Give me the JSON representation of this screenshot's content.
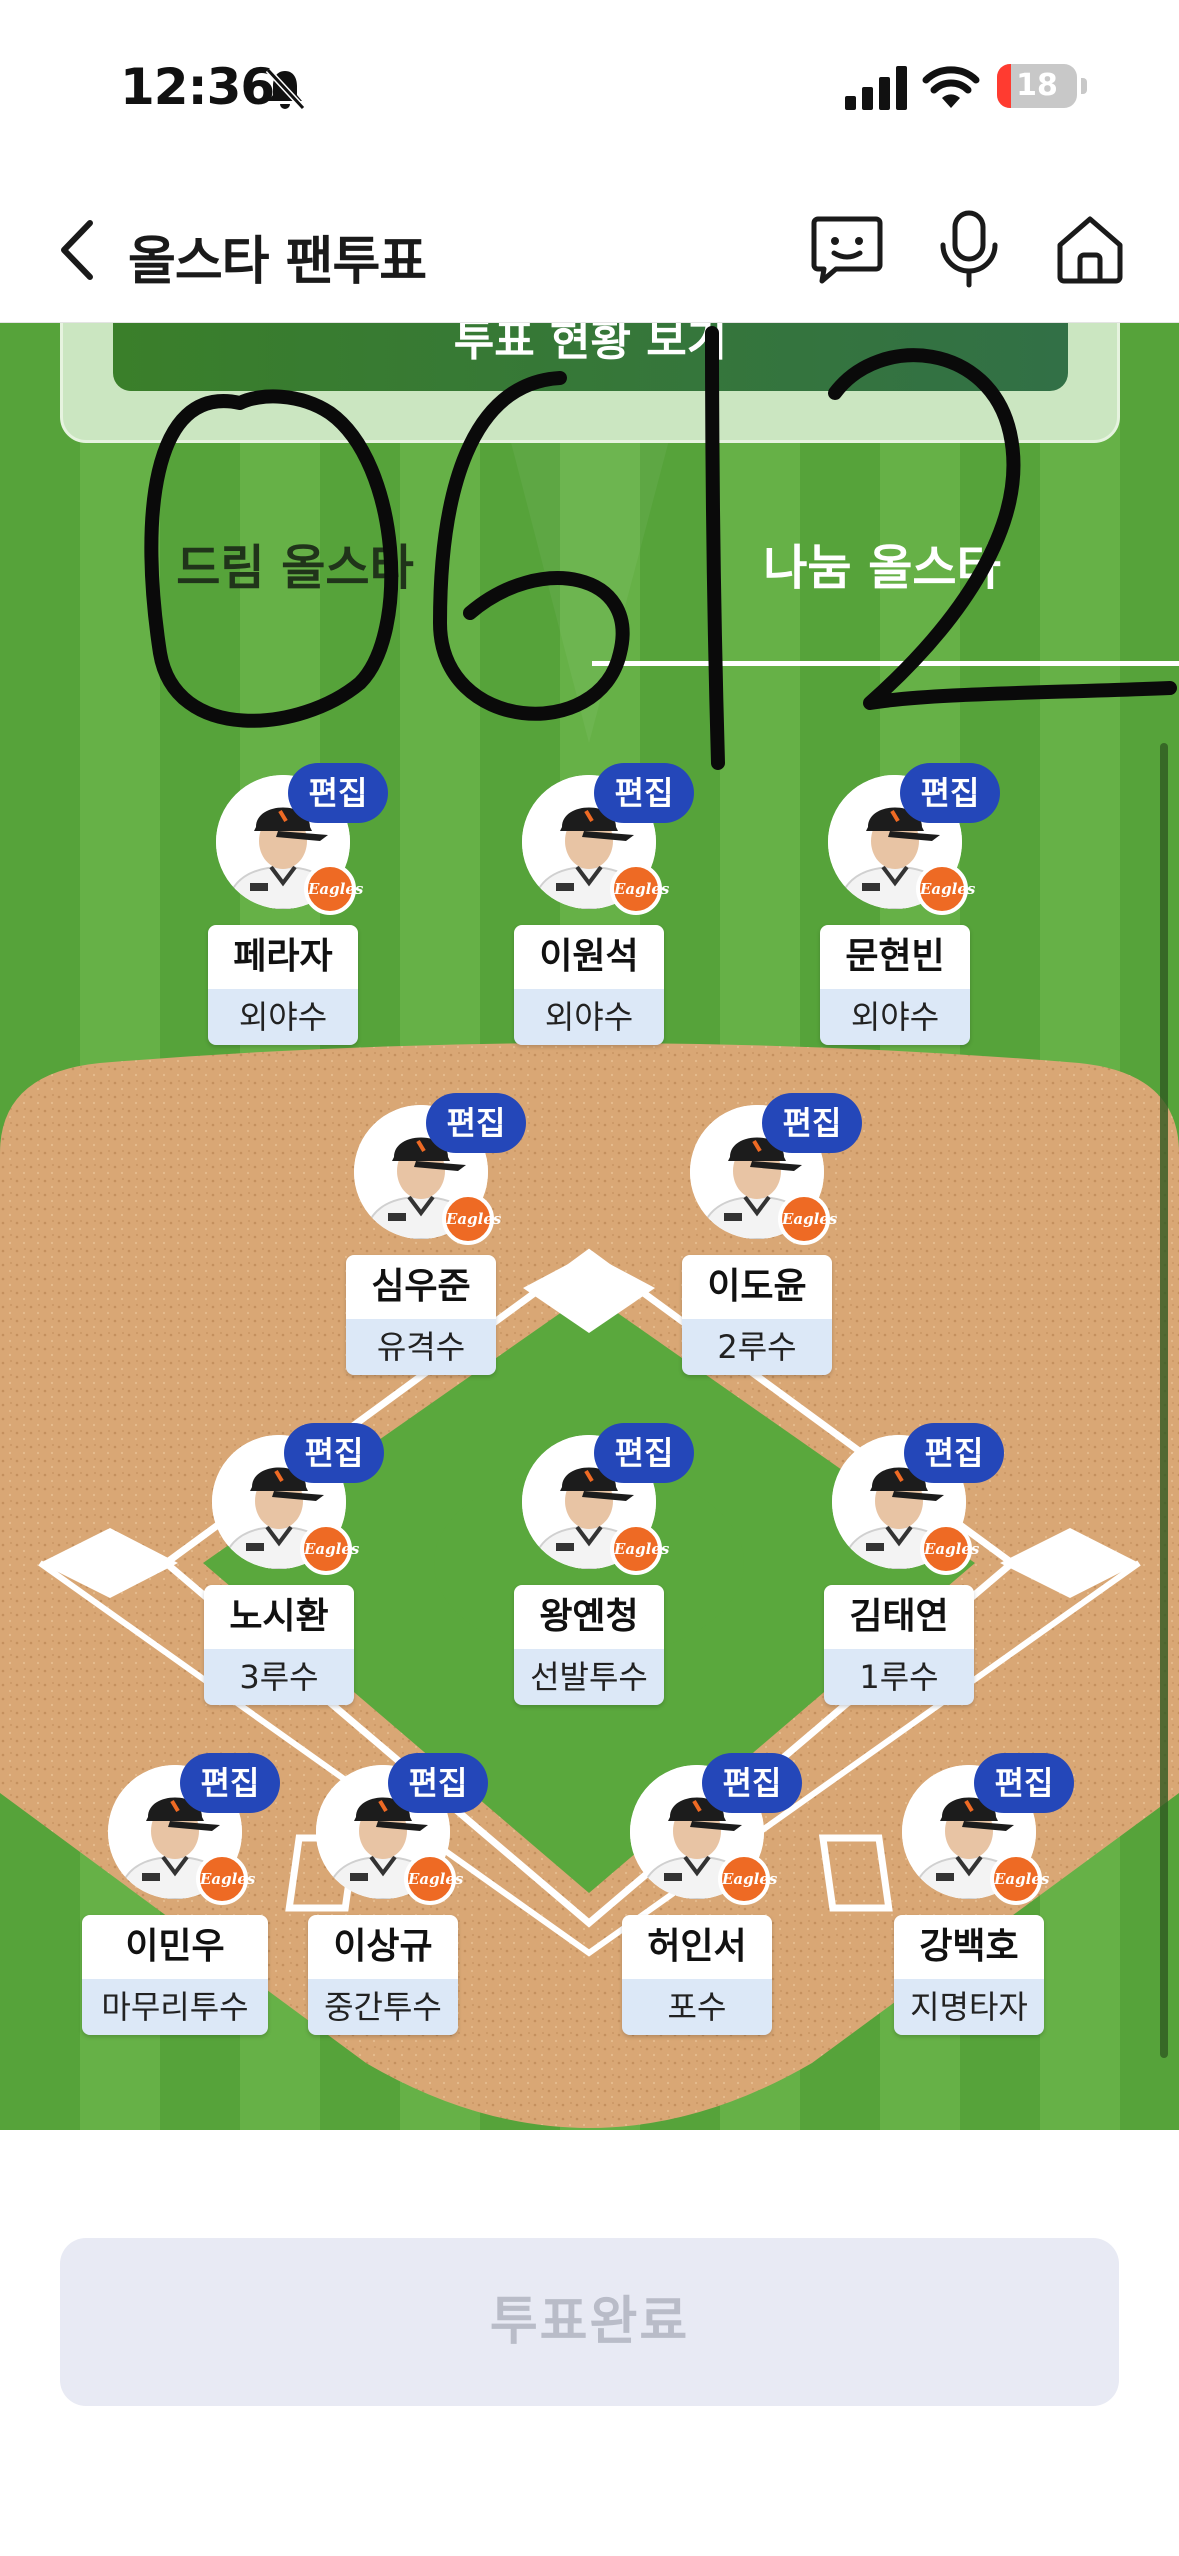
{
  "status_bar": {
    "time": "12:36",
    "battery_level": "18",
    "battery_fraction": 0.18
  },
  "nav": {
    "title": "올스타 팬투표",
    "icons": [
      "back-arrow-icon",
      "chat-bot-icon",
      "microphone-icon",
      "home-icon"
    ]
  },
  "field": {
    "status_button": "투표 현황 보기",
    "tabs": [
      {
        "label": "드림 올스타",
        "selected": false
      },
      {
        "label": "나눔 올스타",
        "selected": true
      }
    ],
    "handwriting": "0612",
    "edit_label": "편집",
    "team_logo": "Eagles",
    "players": [
      {
        "name": "페라자",
        "position": "외야수"
      },
      {
        "name": "이원석",
        "position": "외야수"
      },
      {
        "name": "문현빈",
        "position": "외야수"
      },
      {
        "name": "심우준",
        "position": "유격수"
      },
      {
        "name": "이도윤",
        "position": "2루수"
      },
      {
        "name": "노시환",
        "position": "3루수"
      },
      {
        "name": "왕옌청",
        "position": "선발투수"
      },
      {
        "name": "김태연",
        "position": "1루수"
      },
      {
        "name": "이민우",
        "position": "마무리투수"
      },
      {
        "name": "이상규",
        "position": "중간투수"
      },
      {
        "name": "허인서",
        "position": "포수"
      },
      {
        "name": "강백호",
        "position": "지명타자"
      }
    ]
  },
  "bottom": {
    "submit_label": "투표완료",
    "submit_enabled": false
  },
  "colors": {
    "field_green": "#5aa83d",
    "infield_dirt": "#d9a775",
    "edit_badge": "#2447b9",
    "position_bg": "#dce8f7",
    "logo_orange": "#ee6a24",
    "submit_disabled_bg": "#e8eaf4"
  }
}
